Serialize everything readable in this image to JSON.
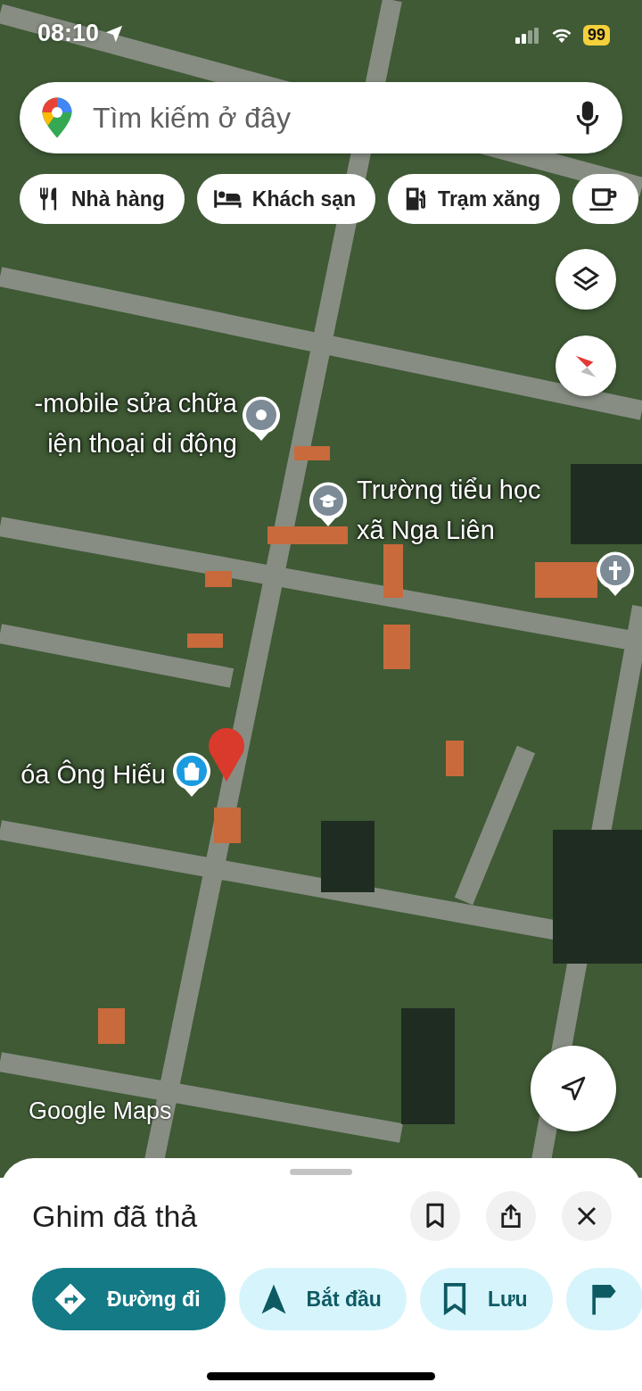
{
  "status_bar": {
    "time": "08:10",
    "battery": "99"
  },
  "search": {
    "placeholder": "Tìm kiếm ở đây"
  },
  "chips": [
    {
      "kind": "restaurant",
      "label": "Nhà hàng"
    },
    {
      "kind": "hotel",
      "label": "Khách sạn"
    },
    {
      "kind": "gas",
      "label": "Trạm xăng"
    },
    {
      "kind": "cafe"
    }
  ],
  "map": {
    "places": [
      {
        "kind": "generic",
        "text": "-mobile sửa chữa\niện thoại di động"
      },
      {
        "kind": "school",
        "text": "Trường tiểu học\nxã Nga Liên"
      },
      {
        "kind": "church"
      },
      {
        "kind": "shop",
        "text": "óa Ông Hiếu"
      }
    ],
    "attribution": "Google Maps"
  },
  "sheet": {
    "title": "Ghim đã thả",
    "icon_buttons": [
      {
        "kind": "save"
      },
      {
        "kind": "share"
      },
      {
        "kind": "close"
      }
    ],
    "actions": [
      {
        "kind": "directions",
        "label": "Đường đi",
        "primary": true
      },
      {
        "kind": "start",
        "label": "Bắt đầu",
        "primary": false
      },
      {
        "kind": "save",
        "label": "Lưu",
        "primary": false
      },
      {
        "kind": "flag",
        "primary": false
      }
    ]
  }
}
